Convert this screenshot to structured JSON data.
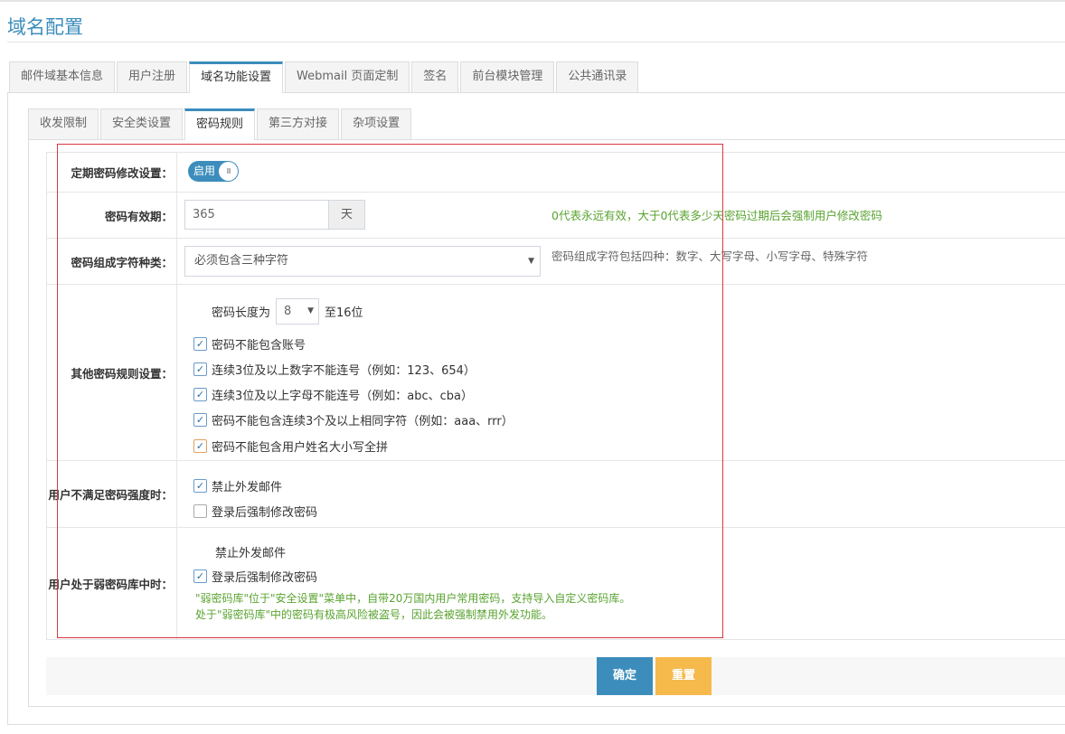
{
  "page": {
    "title": "域名配置"
  },
  "tabs_main": [
    {
      "label": "邮件域基本信息",
      "active": false
    },
    {
      "label": "用户注册",
      "active": false
    },
    {
      "label": "域名功能设置",
      "active": true
    },
    {
      "label": "Webmail 页面定制",
      "active": false
    },
    {
      "label": "签名",
      "active": false
    },
    {
      "label": "前台模块管理",
      "active": false
    },
    {
      "label": "公共通讯录",
      "active": false
    }
  ],
  "tabs_sub": [
    {
      "label": "收发限制",
      "active": false
    },
    {
      "label": "安全类设置",
      "active": false
    },
    {
      "label": "密码规则",
      "active": true
    },
    {
      "label": "第三方对接",
      "active": false
    },
    {
      "label": "杂项设置",
      "active": false
    }
  ],
  "form": {
    "periodic": {
      "label": "定期密码修改设置：",
      "toggle_text": "启用",
      "toggle_knob": "III"
    },
    "validity": {
      "label": "密码有效期：",
      "value": "365",
      "unit": "天",
      "hint": "0代表永远有效，大于0代表多少天密码过期后会强制用户修改密码"
    },
    "charset": {
      "label": "密码组成字符种类：",
      "selected": "必须包含三种字符",
      "hint": "密码组成字符包括四种：数字、大写字母、小写字母、特殊字符"
    },
    "other": {
      "label": "其他密码规则设置：",
      "length_prefix": "密码长度为",
      "length_value": "8",
      "length_suffix": "至16位",
      "rules": [
        {
          "text": "密码不能包含账号",
          "checked": true
        },
        {
          "text": "连续3位及以上数字不能连号（例如：123、654）",
          "checked": true
        },
        {
          "text": "连续3位及以上字母不能连号（例如：abc、cba）",
          "checked": true
        },
        {
          "text": "密码不能包含连续3个及以上相同字符（例如：aaa、rrr）",
          "checked": true
        },
        {
          "text": "密码不能包含用户姓名大小写全拼",
          "checked": true
        }
      ]
    },
    "weak_strength": {
      "label": "用户不满足密码强度时：",
      "options": [
        {
          "text": "禁止外发邮件",
          "checked": true
        },
        {
          "text": "登录后强制修改密码",
          "checked": false
        }
      ]
    },
    "weak_library": {
      "label": "用户处于弱密码库中时：",
      "plain_text": "禁止外发邮件",
      "option": {
        "text": "登录后强制修改密码",
        "checked": true
      },
      "note_line1": "\"弱密码库\"位于\"安全设置\"菜单中，自带20万国内用户常用密码，支持导入自定义密码库。",
      "note_line2": "处于\"弱密码库\"中的密码有极高风险被盗号，因此会被强制禁用外发功能。"
    }
  },
  "buttons": {
    "ok": "确定",
    "reset": "重置"
  },
  "icons": {
    "check": "✓",
    "dropdown_arrow": "▼"
  },
  "colors": {
    "accent": "#3c8dbc",
    "hint_green": "#59a32f",
    "highlight_red": "#d9393f",
    "reset_orange": "#f5b94c"
  }
}
